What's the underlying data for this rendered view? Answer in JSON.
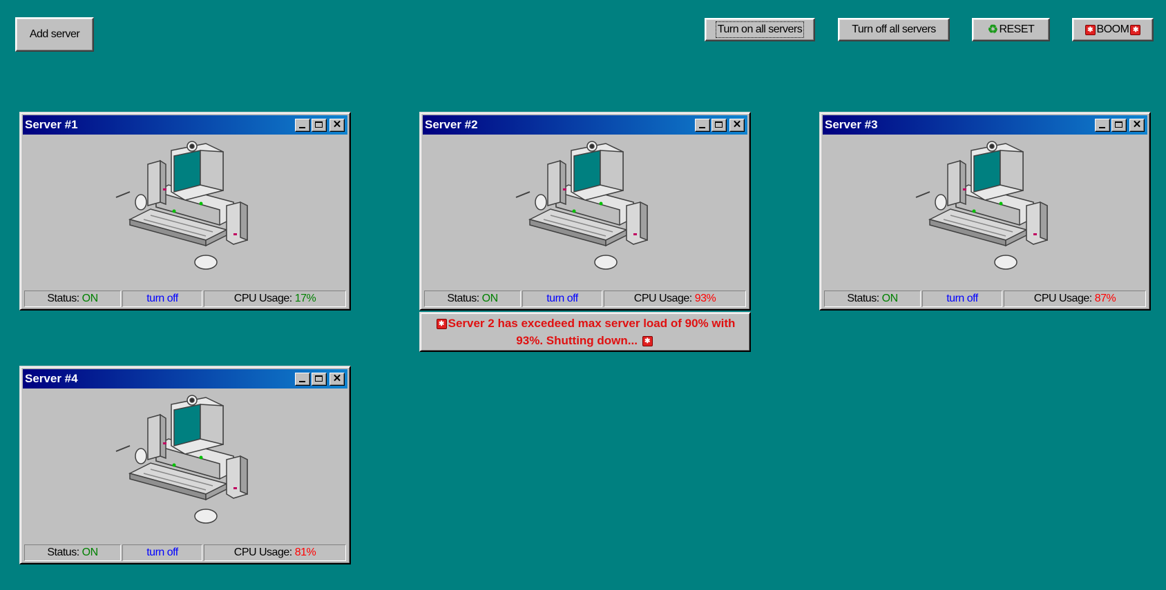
{
  "toolbar": {
    "add_server": "Add server",
    "turn_on_all": "Turn on all servers",
    "turn_off_all": "Turn off all servers",
    "reset": "RESET",
    "boom": "BOOM"
  },
  "status_label": "Status:",
  "cpu_label": "CPU Usage:",
  "servers": [
    {
      "title": "Server #1",
      "status": "ON",
      "action": "turn off",
      "cpu": "17%",
      "cpu_color": "#008000"
    },
    {
      "title": "Server #2",
      "status": "ON",
      "action": "turn off",
      "cpu": "93%",
      "cpu_color": "#ff0000"
    },
    {
      "title": "Server #3",
      "status": "ON",
      "action": "turn off",
      "cpu": "87%",
      "cpu_color": "#ff0000"
    },
    {
      "title": "Server #4",
      "status": "ON",
      "action": "turn off",
      "cpu": "81%",
      "cpu_color": "#ff0000"
    }
  ],
  "alert": {
    "line1": "Server 2 has excedeed max server load of 90% with",
    "line2": "93%. Shutting down..."
  },
  "colors": {
    "desktop": "#008080",
    "status_on": "#008000",
    "cpu_high": "#ff0000",
    "link": "#0000ff",
    "alert": "#e01010"
  },
  "icons": [
    "minimize-icon",
    "maximize-icon",
    "close-icon",
    "recycle-icon",
    "bomb-icon",
    "computer-icon"
  ]
}
